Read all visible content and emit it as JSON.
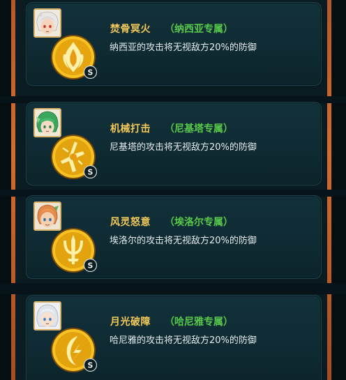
{
  "skills": [
    {
      "name": "焚骨冥火",
      "hero_tag": "（纳西亚专属）",
      "description": "纳西亚的攻击将无视敌方20%的防御",
      "medal_icon": "flame-emblem-icon",
      "rank": "S",
      "hair_color": "#e9e6e6"
    },
    {
      "name": "机械打击",
      "hero_tag": "（尼基塔专属）",
      "description": "尼基塔的攻击将无视敌方20%的防御",
      "medal_icon": "mechanical-strike-emblem-icon",
      "rank": "S",
      "hair_color": "#3aa55d"
    },
    {
      "name": "风灵怒意",
      "hero_tag": "（埃洛尔专属）",
      "description": "埃洛尔的攻击将无视敌方20%的防御",
      "medal_icon": "trident-emblem-icon",
      "rank": "S",
      "hair_color": "#e08a4b"
    },
    {
      "name": "月光破障",
      "hero_tag": "（哈尼雅专属）",
      "description": "哈尼雅的攻击将无视敌方20%的防御",
      "medal_icon": "moonlight-emblem-icon",
      "rank": "S",
      "hair_color": "#dfe4ea"
    }
  ],
  "colors": {
    "skill_name": "#f2c95a",
    "hero_tag": "#58c94b",
    "description": "#e6eef0",
    "frame_accent": "#d56c31"
  }
}
